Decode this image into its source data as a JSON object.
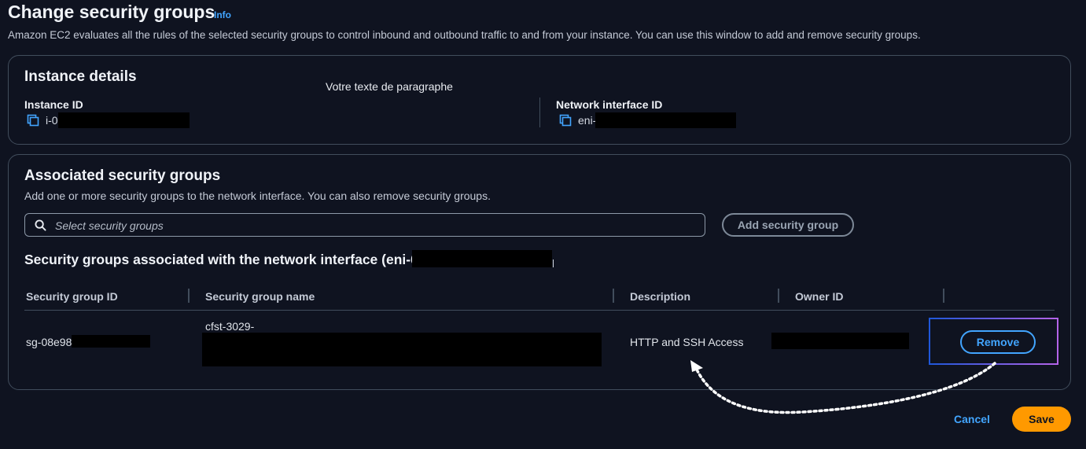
{
  "header": {
    "title": "Change security groups",
    "info_link": "Info",
    "description": "Amazon EC2 evaluates all the rules of the selected security groups to control inbound and outbound traffic to and from your instance. You can use this window to add and remove security groups."
  },
  "instance_details": {
    "heading": "Instance details",
    "instance_id_label": "Instance ID",
    "instance_id_value": "i-0",
    "network_interface_label": "Network interface ID",
    "network_interface_value": "eni-",
    "paragraph_text": "Votre texte de paragraphe"
  },
  "associated": {
    "heading": "Associated security groups",
    "hint": "Add one or more security groups to the network interface. You can also remove security groups.",
    "search_placeholder": "Select security groups",
    "add_button": "Add security group",
    "table_heading": "Security groups associated with the network interface (eni-0",
    "columns": [
      "Security group ID",
      "Security group name",
      "Description",
      "Owner ID"
    ],
    "rows": [
      {
        "id": "sg-08e98",
        "name": "cfst-3029-",
        "description": "HTTP and SSH Access",
        "owner": "",
        "action": "Remove"
      }
    ]
  },
  "footer": {
    "cancel": "Cancel",
    "save": "Save"
  },
  "colors": {
    "background": "#0f1320",
    "link": "#42a5ff",
    "primary": "#ff9900",
    "border": "#414d5c"
  },
  "icons": [
    "copy-icon",
    "search-icon",
    "dotted-arrow-annotation"
  ]
}
